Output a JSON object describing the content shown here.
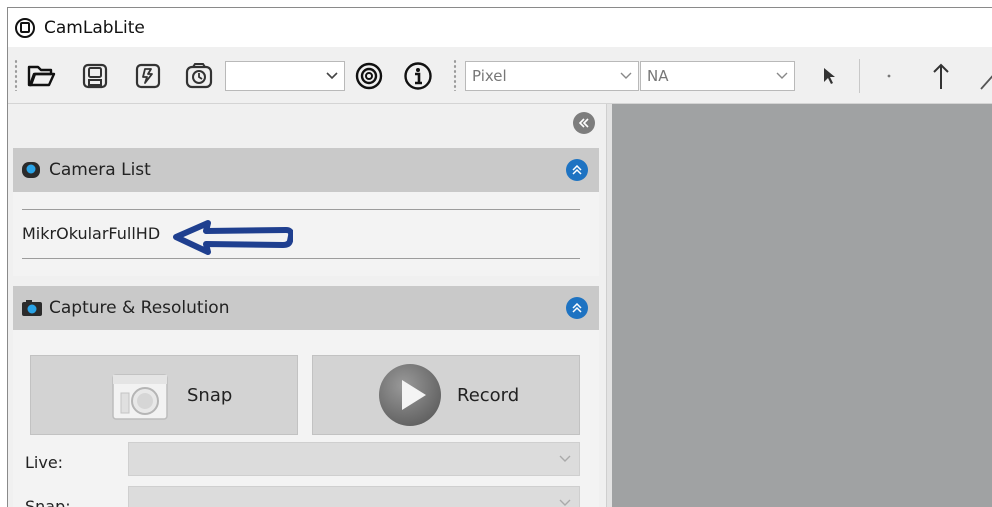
{
  "window": {
    "title": "CamLabLite"
  },
  "toolbar": {
    "resolution_select": {
      "value": ""
    },
    "unit_select": {
      "value": "Pixel"
    },
    "na_select": {
      "value": "NA"
    }
  },
  "camera_list": {
    "title": "Camera List",
    "items": [
      "MikrOkularFullHD"
    ]
  },
  "capture": {
    "title": "Capture & Resolution",
    "snap_label": "Snap",
    "record_label": "Record",
    "live_label": "Live:",
    "snap_field_label": "Snap:"
  },
  "colors": {
    "accent_blue": "#1e73c2",
    "arrow_annotation": "#1f3f8f",
    "viewer_bg": "#a0a2a3",
    "section_header": "#c9c9c9"
  }
}
